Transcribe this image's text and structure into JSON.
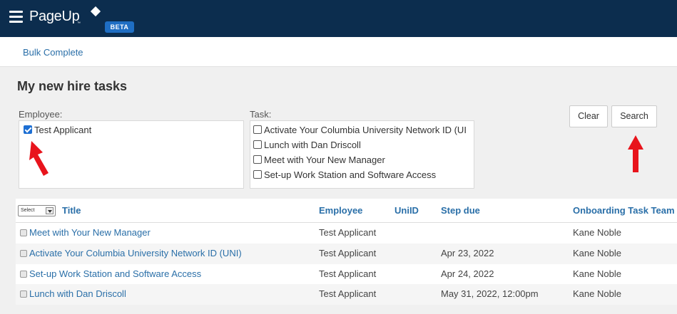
{
  "app": {
    "logo_text": "PageUp",
    "logo_tm": "™",
    "badge": "BETA"
  },
  "subnav": {
    "bulk_complete": "Bulk Complete"
  },
  "page": {
    "title": "My new hire tasks"
  },
  "filters": {
    "employee_label": "Employee:",
    "employees": [
      {
        "name": "Test Applicant",
        "checked": true
      }
    ],
    "task_label": "Task:",
    "tasks": [
      {
        "name": "Activate Your Columbia University Network ID (UI",
        "checked": false
      },
      {
        "name": "Lunch with Dan Driscoll",
        "checked": false
      },
      {
        "name": "Meet with Your New Manager",
        "checked": false
      },
      {
        "name": "Set-up Work Station and Software Access",
        "checked": false
      }
    ]
  },
  "buttons": {
    "clear": "Clear",
    "search": "Search"
  },
  "table": {
    "select_label": "Select",
    "headers": {
      "title": "Title",
      "employee": "Employee",
      "uniid": "UniID",
      "step_due": "Step due",
      "team": "Onboarding Task Team"
    },
    "rows": [
      {
        "title": "Meet with Your New Manager",
        "employee": "Test Applicant",
        "uniid": "",
        "step_due": "",
        "team": "Kane Noble"
      },
      {
        "title": "Activate Your Columbia University Network ID (UNI)",
        "employee": "Test Applicant",
        "uniid": "",
        "step_due": "Apr 23, 2022",
        "team": "Kane Noble"
      },
      {
        "title": "Set-up Work Station and Software Access",
        "employee": "Test Applicant",
        "uniid": "",
        "step_due": "Apr 24, 2022",
        "team": "Kane Noble"
      },
      {
        "title": "Lunch with Dan Driscoll",
        "employee": "Test Applicant",
        "uniid": "",
        "step_due": "May 31, 2022, 12:00pm",
        "team": "Kane Noble"
      }
    ]
  },
  "colors": {
    "topbar": "#0c2d4e",
    "link": "#2a6fa8",
    "beta_badge": "#1f6ec3",
    "annotation_arrow": "#e8141c"
  }
}
